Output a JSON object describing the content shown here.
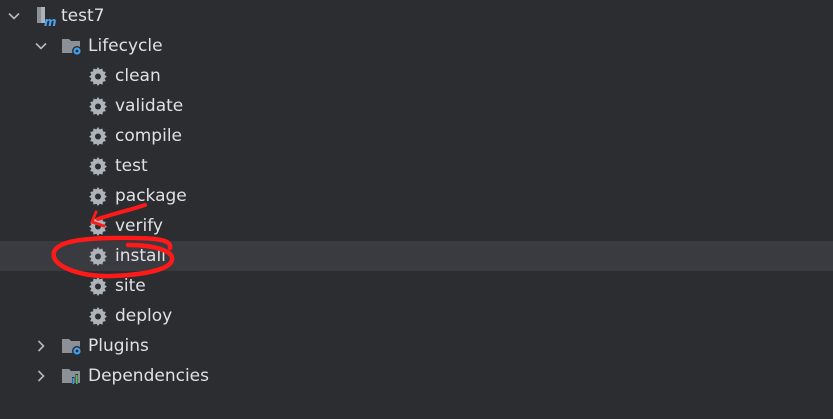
{
  "tree": {
    "root": {
      "label": "test7",
      "expanded": true,
      "icon": "maven-module-icon"
    },
    "lifecycle": {
      "label": "Lifecycle",
      "expanded": true,
      "icon": "folder-gear-icon",
      "goals": [
        {
          "label": "clean"
        },
        {
          "label": "validate"
        },
        {
          "label": "compile"
        },
        {
          "label": "test"
        },
        {
          "label": "package"
        },
        {
          "label": "verify"
        },
        {
          "label": "install",
          "selected": true
        },
        {
          "label": "site"
        },
        {
          "label": "deploy"
        }
      ]
    },
    "plugins": {
      "label": "Plugins",
      "expanded": false,
      "icon": "folder-gear-icon"
    },
    "dependencies": {
      "label": "Dependencies",
      "expanded": false,
      "icon": "folder-chart-icon"
    }
  },
  "colors": {
    "background": "#2b2d30",
    "selected_row": "#393b40",
    "text": "#dfe1e5",
    "icon_gray": "#aeb3ba",
    "annotation_red": "#ff1a1a"
  }
}
